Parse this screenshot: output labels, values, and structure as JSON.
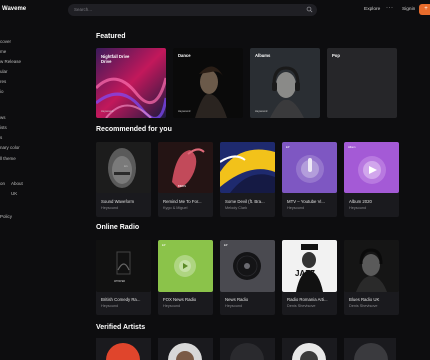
{
  "app": {
    "name": "Waveme"
  },
  "search": {
    "placeholder": "Search..."
  },
  "header": {
    "explore": "Explore",
    "more": "···",
    "signin": "Signin",
    "cta": "+"
  },
  "sidebar": {
    "items": [
      {
        "label": "cover"
      },
      {
        "label": "me"
      },
      {
        "label": "w Release"
      },
      {
        "label": "ular"
      },
      {
        "label": "res"
      },
      {
        "label": "io"
      },
      {
        "label": "ws"
      },
      {
        "label": "ists"
      },
      {
        "label": "s"
      },
      {
        "label": "nary color"
      },
      {
        "label": "ll theme"
      },
      {
        "label": "on"
      },
      {
        "label": "About"
      },
      {
        "label": "UK"
      },
      {
        "label": "Policy"
      }
    ]
  },
  "featured": {
    "title": "Featured",
    "items": [
      {
        "label": "Nightfall Drive",
        "line2": "Drive",
        "note": "Heywound"
      },
      {
        "label": "Dance",
        "note": "Heywound"
      },
      {
        "label": "Albums",
        "note": "Heywound"
      },
      {
        "label": "Pop"
      }
    ]
  },
  "recommended": {
    "title": "Recommended for you",
    "items": [
      {
        "title": "Sound Waveform",
        "sub": "Heysound",
        "art_label": "Lin"
      },
      {
        "title": "Remind Me To For...",
        "sub": "Kygo & Miguel",
        "art_label": "BIRDS"
      },
      {
        "title": "Some Devil (ft. Bra...",
        "sub": "Melody Clark"
      },
      {
        "title": "MTV – Youtube Vi...",
        "sub": "Heysound",
        "art_label": "EP"
      },
      {
        "title": "Album 2020",
        "sub": "Heysound",
        "art_label": "Album"
      }
    ]
  },
  "radio": {
    "title": "Online Radio",
    "items": [
      {
        "title": "British Comedy Ra...",
        "sub": "Heysound",
        "art_label": "WHISPER"
      },
      {
        "title": "FOX News Radio",
        "sub": "Heysound",
        "art_label": "EP"
      },
      {
        "title": "News Radio",
        "sub": "Heysound",
        "art_label": "EP"
      },
      {
        "title": "Radio Romania Arti...",
        "sub": "Denis Shevtsove",
        "art_label": "JAZZ"
      },
      {
        "title": "Blues Radio UK",
        "sub": "Denis Shevtsove"
      }
    ]
  },
  "artists": {
    "title": "Verified Artists"
  },
  "colors": {
    "accent": "#e86c2c",
    "bg": "#0d0d0f",
    "card": "#1a1a1e"
  },
  "icons": {
    "search": "search-icon",
    "play": "play-icon",
    "record": "record-icon"
  }
}
